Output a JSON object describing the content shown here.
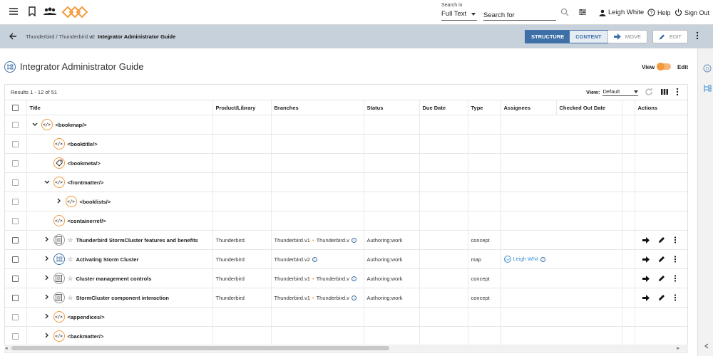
{
  "header": {
    "search_in_label": "Search in",
    "search_in_value": "Full Text",
    "search_placeholder": "Search for",
    "user_name": "Leigh White",
    "help": "Help",
    "sign_out": "Sign Out"
  },
  "breadcrumb": {
    "path": "Thunderbird / Thunderbird.v2",
    "current": "Integrator Administrator Guide"
  },
  "toolbar": {
    "structure": "STRUCTURE",
    "content": "CONTENT",
    "move": "MOVE",
    "edit": "EDIT"
  },
  "page": {
    "title": "Integrator Administrator Guide",
    "view_label": "View",
    "edit_label": "Edit"
  },
  "results": {
    "summary": "Results 1 - 12 of 51",
    "view_label": "View:",
    "view_value": "Default"
  },
  "columns": [
    "Title",
    "Product/Library",
    "Branches",
    "Status",
    "Due Date",
    "Type",
    "Assignees",
    "Checked Out Date",
    "Actions"
  ],
  "rows": [
    {
      "level": 0,
      "chevron": "down",
      "icon": "xml",
      "title": "<bookmap/>"
    },
    {
      "level": 1,
      "chevron": "",
      "icon": "xml",
      "title": "<booktitle/>"
    },
    {
      "level": 1,
      "chevron": "",
      "icon": "tag",
      "title": "<bookmeta/>"
    },
    {
      "level": 1,
      "chevron": "down",
      "icon": "xml",
      "title": "<frontmatter/>"
    },
    {
      "level": 2,
      "chevron": "right",
      "icon": "xml",
      "title": "<booklists/>"
    },
    {
      "level": 1,
      "chevron": "",
      "icon": "xml",
      "title": "<containerref/>"
    },
    {
      "level": 1,
      "chevron": "right",
      "icon": "topic",
      "star": true,
      "title": "Thunderbird StormCluster features and benefits",
      "product": "Thunderbird",
      "branch1": "Thunderbird.v1",
      "branch2": "Thunderbird.v",
      "status": "Authoring:work",
      "type": "concept",
      "actions": true
    },
    {
      "level": 1,
      "chevron": "right",
      "icon": "map",
      "star": true,
      "title": "Activating Storm Cluster",
      "product": "Thunderbird",
      "branch1": "Thunderbird.v2",
      "status": "Authoring:work",
      "type": "map",
      "assignee_initials": "LW",
      "assignee": "Leigh Whit",
      "actions": true
    },
    {
      "level": 1,
      "chevron": "right",
      "icon": "topic",
      "star": true,
      "title": "Cluster management controls",
      "product": "Thunderbird",
      "branch1": "Thunderbird.v1",
      "branch2": "Thunderbird.v",
      "status": "Authoring:work",
      "type": "concept",
      "actions": true
    },
    {
      "level": 1,
      "chevron": "right",
      "icon": "topic",
      "star": true,
      "title": "StormCluster component interaction",
      "product": "Thunderbird",
      "branch1": "Thunderbird.v1",
      "branch2": "Thunderbird.v",
      "status": "Authoring:work",
      "type": "concept",
      "actions": true
    },
    {
      "level": 1,
      "chevron": "right",
      "icon": "xml",
      "title": "<appendices/>"
    },
    {
      "level": 1,
      "chevron": "right",
      "icon": "xml",
      "title": "<backmatter/>"
    }
  ],
  "icons": {
    "xml": "</>",
    "info": "i",
    "chevron_down": "⌄",
    "chevron_right": "›",
    "star": "☆"
  },
  "colors": {
    "accent_orange": "#f39a3c",
    "accent_blue": "#3e6fa6",
    "crumb_bg": "#c7d1dc"
  }
}
